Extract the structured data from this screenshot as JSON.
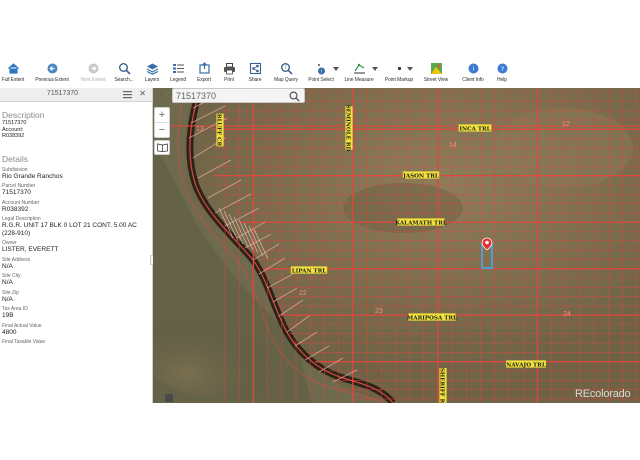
{
  "toolbar": {
    "items": [
      {
        "id": "full-extent",
        "label": "Full Extent",
        "icon": "home-icon",
        "enabled": true
      },
      {
        "id": "previous-extent",
        "label": "Previous Extent",
        "icon": "arrow-left-icon",
        "enabled": true
      },
      {
        "id": "next-extent",
        "label": "Next Extent",
        "icon": "arrow-right-icon",
        "enabled": false
      },
      {
        "id": "search",
        "label": "Search...",
        "icon": "search-icon",
        "enabled": true
      },
      {
        "id": "layers",
        "label": "Layers",
        "icon": "layers-icon",
        "enabled": true
      },
      {
        "id": "legend",
        "label": "Legend",
        "icon": "legend-icon",
        "enabled": true
      },
      {
        "id": "export",
        "label": "Export",
        "icon": "export-icon",
        "enabled": true
      },
      {
        "id": "print",
        "label": "Print",
        "icon": "print-icon",
        "enabled": true
      },
      {
        "id": "share",
        "label": "Share",
        "icon": "share-icon",
        "enabled": true
      },
      {
        "id": "map-query",
        "label": "Map Query",
        "icon": "map-query-icon",
        "enabled": true
      },
      {
        "id": "point-select",
        "label": "Point Select",
        "icon": "point-select-icon",
        "enabled": true
      },
      {
        "id": "line-measure",
        "label": "Line Measure",
        "icon": "line-measure-icon",
        "enabled": true
      },
      {
        "id": "point-markup",
        "label": "Point Markup",
        "icon": "point-markup-icon",
        "enabled": true
      },
      {
        "id": "street-view",
        "label": "Street View",
        "icon": "street-view-icon",
        "enabled": true
      },
      {
        "id": "client-info",
        "label": "Client Info",
        "icon": "client-info-icon",
        "enabled": true
      },
      {
        "id": "help",
        "label": "Help",
        "icon": "help-icon",
        "enabled": true
      }
    ]
  },
  "sidebar": {
    "title": "71517370",
    "menu_icon": "hamburger-icon",
    "close_icon": "close-icon",
    "description": {
      "heading": "Description",
      "lines": [
        "71517370",
        "Account:",
        "R038392"
      ]
    },
    "details": {
      "heading": "Details",
      "fields": [
        {
          "label": "Subdivision",
          "value": "Rio Grande Ranchos"
        },
        {
          "label": "Parcel Number",
          "value": "71517370"
        },
        {
          "label": "Account Number",
          "value": "R038392"
        },
        {
          "label": "Legal Description",
          "value": "R.G.R. UNIT 17 BLK 0 LOT 21 CONT. 5.00 AC (228-910)"
        },
        {
          "label": "Owner",
          "value": "LISTER, EVERETT"
        },
        {
          "label": "Site Address",
          "value": "N/A"
        },
        {
          "label": "Site City",
          "value": "N/A"
        },
        {
          "label": "Site Zip",
          "value": "N/A"
        },
        {
          "label": "Tax Area ID",
          "value": "19B"
        },
        {
          "label": "Final Actual Value",
          "value": "4800"
        },
        {
          "label": "Final Taxable Value",
          "value": ""
        }
      ]
    }
  },
  "map": {
    "search": {
      "value": "71517370",
      "icon": "search-icon"
    },
    "collapse_icon": "chevron-left-icon",
    "zoom_in_label": "+",
    "zoom_out_label": "−",
    "bookmark_icon": "book-icon",
    "watermark": "REcolorado",
    "road_labels": [
      "INCA TRL",
      "JASON TRL",
      "KALAMATH TRL",
      "LIPAN TRL",
      "MARIPOSA TRL",
      "NAVAJO TRL",
      "BLUFF CR",
      "SEMINOLE RD",
      "SHERIFF RD"
    ],
    "block_numbers": [
      "13",
      "14",
      "12",
      "22",
      "23",
      "24"
    ],
    "marker_icon": "map-pin-icon",
    "colors": {
      "terrain": "#7d6f50",
      "parcel_lines": "#e0473f",
      "road_label_bg": "#f2e23a",
      "selected_parcel": "#36b0e8",
      "marker": "#e03030"
    }
  }
}
